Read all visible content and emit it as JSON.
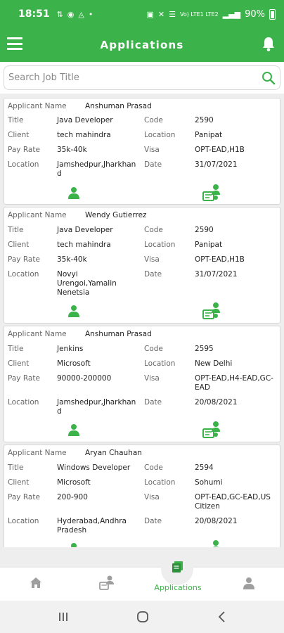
{
  "status_bar": {
    "time": "18:51",
    "left_icons": [
      "data-icon",
      "location-icon",
      "vpn-icon",
      "dot-icon"
    ],
    "right_text": "Vo) LTE1 LTE2",
    "battery": "90%"
  },
  "app_bar": {
    "title": "Applications"
  },
  "search": {
    "placeholder": "Search Job Title"
  },
  "labels": {
    "applicant_name": "Applicant Name",
    "title": "Title",
    "code": "Code",
    "client": "Client",
    "location": "Location",
    "pay_rate": "Pay Rate",
    "visa": "Visa",
    "date": "Date"
  },
  "applications": [
    {
      "applicant": "Anshuman Prasad",
      "title": "Java Developer",
      "code": "2590",
      "client": "tech mahindra",
      "job_location": "Panipat",
      "pay_rate": "35k-40k",
      "visa": "OPT-EAD,H1B",
      "location": "Jamshedpur,Jharkhand",
      "date": "31/07/2021"
    },
    {
      "applicant": "Wendy Gutierrez",
      "title": "Java Developer",
      "code": "2590",
      "client": "tech mahindra",
      "job_location": "Panipat",
      "pay_rate": "35k-40k",
      "visa": "OPT-EAD,H1B",
      "location": "Novyi Urengoi,Yamalin Nenetsia",
      "date": "31/07/2021"
    },
    {
      "applicant": "Anshuman Prasad",
      "title": "Jenkins",
      "code": "2595",
      "client": "Microsoft",
      "job_location": "New Delhi",
      "pay_rate": "90000-200000",
      "visa": "OPT-EAD,H4-EAD,GC-EAD",
      "location": "Jamshedpur,Jharkhand",
      "date": "20/08/2021"
    },
    {
      "applicant": "Aryan Chauhan",
      "title": "Windows Developer",
      "code": "2594",
      "client": "Microsoft",
      "job_location": "Sohumi",
      "pay_rate": "200-900",
      "visa": "OPT-EAD,GC-EAD,US Citizen",
      "location": "Hyderabad,Andhra Pradesh",
      "date": "20/08/2021"
    }
  ],
  "bottom_nav": {
    "items": [
      "home-icon",
      "job-seeker-icon",
      "applications-icon",
      "profile-icon"
    ],
    "active_label": "Applications"
  },
  "system_nav": [
    "recents-button",
    "home-button",
    "back-button"
  ],
  "colors": {
    "brand_green": "#3bb34a",
    "list_background": "#eeeeee"
  }
}
